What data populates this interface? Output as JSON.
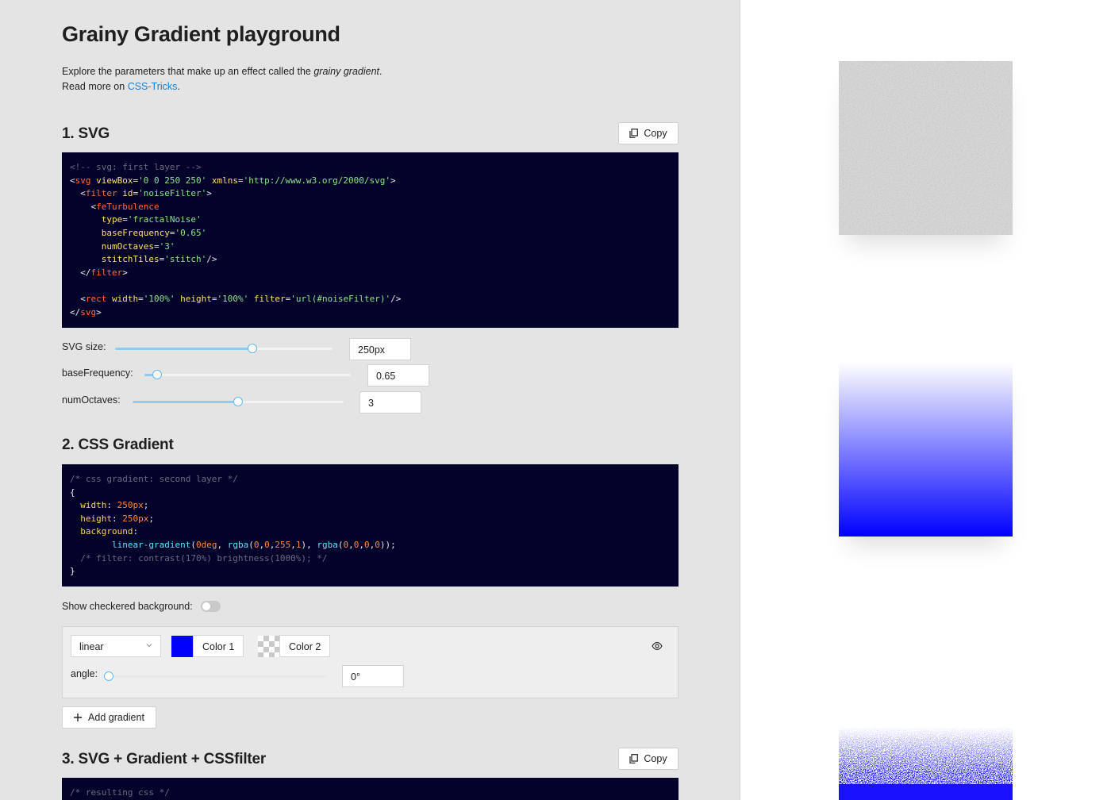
{
  "page": {
    "title": "Grainy Gradient playground",
    "intro_line1_prefix": "Explore the parameters that make up an effect called the ",
    "intro_line1_em": "grainy gradient",
    "intro_line1_suffix": ".",
    "intro_line2_prefix": "Read more on ",
    "intro_link": "CSS-Tricks",
    "intro_line2_suffix": "."
  },
  "section1": {
    "heading": "1. SVG",
    "copy_label": "Copy",
    "code_lines": [
      [
        {
          "c": "cm",
          "t": "<!-- svg: first layer -->"
        }
      ],
      [
        {
          "c": "pn",
          "t": "<"
        },
        {
          "c": "tg",
          "t": "svg"
        },
        {
          "c": "pn",
          "t": " "
        },
        {
          "c": "at",
          "t": "viewBox"
        },
        {
          "c": "pn",
          "t": "="
        },
        {
          "c": "st",
          "t": "'0 0 250 250'"
        },
        {
          "c": "pn",
          "t": " "
        },
        {
          "c": "at",
          "t": "xmlns"
        },
        {
          "c": "pn",
          "t": "="
        },
        {
          "c": "st",
          "t": "'http://www.w3.org/2000/svg'"
        },
        {
          "c": "pn",
          "t": ">"
        }
      ],
      [
        {
          "c": "pn",
          "t": "  <"
        },
        {
          "c": "tg",
          "t": "filter"
        },
        {
          "c": "pn",
          "t": " "
        },
        {
          "c": "at",
          "t": "id"
        },
        {
          "c": "pn",
          "t": "="
        },
        {
          "c": "st",
          "t": "'noiseFilter'"
        },
        {
          "c": "pn",
          "t": ">"
        }
      ],
      [
        {
          "c": "pn",
          "t": "    <"
        },
        {
          "c": "tg",
          "t": "feTurbulence"
        }
      ],
      [
        {
          "c": "pn",
          "t": "      "
        },
        {
          "c": "at",
          "t": "type"
        },
        {
          "c": "pn",
          "t": "="
        },
        {
          "c": "st",
          "t": "'fractalNoise'"
        }
      ],
      [
        {
          "c": "pn",
          "t": "      "
        },
        {
          "c": "at",
          "t": "baseFrequency"
        },
        {
          "c": "pn",
          "t": "="
        },
        {
          "c": "st",
          "t": "'0.65'"
        }
      ],
      [
        {
          "c": "pn",
          "t": "      "
        },
        {
          "c": "at",
          "t": "numOctaves"
        },
        {
          "c": "pn",
          "t": "="
        },
        {
          "c": "st",
          "t": "'3'"
        }
      ],
      [
        {
          "c": "pn",
          "t": "      "
        },
        {
          "c": "at",
          "t": "stitchTiles"
        },
        {
          "c": "pn",
          "t": "="
        },
        {
          "c": "st",
          "t": "'stitch'"
        },
        {
          "c": "pn",
          "t": "/>"
        }
      ],
      [
        {
          "c": "pn",
          "t": "  </"
        },
        {
          "c": "tg",
          "t": "filter"
        },
        {
          "c": "pn",
          "t": ">"
        }
      ],
      [
        {
          "c": "pn",
          "t": ""
        }
      ],
      [
        {
          "c": "pn",
          "t": "  <"
        },
        {
          "c": "tg",
          "t": "rect"
        },
        {
          "c": "pn",
          "t": " "
        },
        {
          "c": "at",
          "t": "width"
        },
        {
          "c": "pn",
          "t": "="
        },
        {
          "c": "st",
          "t": "'100%'"
        },
        {
          "c": "pn",
          "t": " "
        },
        {
          "c": "at",
          "t": "height"
        },
        {
          "c": "pn",
          "t": "="
        },
        {
          "c": "st",
          "t": "'100%'"
        },
        {
          "c": "pn",
          "t": " "
        },
        {
          "c": "at",
          "t": "filter"
        },
        {
          "c": "pn",
          "t": "="
        },
        {
          "c": "st",
          "t": "'url(#noiseFilter)'"
        },
        {
          "c": "pn",
          "t": "/>"
        }
      ],
      [
        {
          "c": "pn",
          "t": "</"
        },
        {
          "c": "tg",
          "t": "svg"
        },
        {
          "c": "pn",
          "t": ">"
        }
      ]
    ],
    "controls": [
      {
        "label": "SVG size",
        "value": "250px",
        "fraction": 0.63
      },
      {
        "label": "baseFrequency",
        "value": "0.65",
        "fraction": 0.06
      },
      {
        "label": "numOctaves",
        "value": "3",
        "fraction": 0.5
      }
    ]
  },
  "section2": {
    "heading": "2. CSS Gradient",
    "code_lines": [
      [
        {
          "c": "cm",
          "t": "/* css gradient: second layer */"
        }
      ],
      [
        {
          "c": "pn",
          "t": "{"
        }
      ],
      [
        {
          "c": "pn",
          "t": "  "
        },
        {
          "c": "pr",
          "t": "width"
        },
        {
          "c": "pn",
          "t": ": "
        },
        {
          "c": "nu",
          "t": "250px"
        },
        {
          "c": "pn",
          "t": ";"
        }
      ],
      [
        {
          "c": "pn",
          "t": "  "
        },
        {
          "c": "pr",
          "t": "height"
        },
        {
          "c": "pn",
          "t": ": "
        },
        {
          "c": "nu",
          "t": "250px"
        },
        {
          "c": "pn",
          "t": ";"
        }
      ],
      [
        {
          "c": "pn",
          "t": "  "
        },
        {
          "c": "pr",
          "t": "background"
        },
        {
          "c": "pn",
          "t": ":"
        }
      ],
      [
        {
          "c": "pn",
          "t": "        "
        },
        {
          "c": "fn",
          "t": "linear-gradient"
        },
        {
          "c": "pn",
          "t": "("
        },
        {
          "c": "nu",
          "t": "0deg"
        },
        {
          "c": "pn",
          "t": ", "
        },
        {
          "c": "fn",
          "t": "rgba"
        },
        {
          "c": "pn",
          "t": "("
        },
        {
          "c": "nu",
          "t": "0"
        },
        {
          "c": "pn",
          "t": ","
        },
        {
          "c": "nu",
          "t": "0"
        },
        {
          "c": "pn",
          "t": ","
        },
        {
          "c": "nu",
          "t": "255"
        },
        {
          "c": "pn",
          "t": ","
        },
        {
          "c": "nu",
          "t": "1"
        },
        {
          "c": "pn",
          "t": "), "
        },
        {
          "c": "fn",
          "t": "rgba"
        },
        {
          "c": "pn",
          "t": "("
        },
        {
          "c": "nu",
          "t": "0"
        },
        {
          "c": "pn",
          "t": ","
        },
        {
          "c": "nu",
          "t": "0"
        },
        {
          "c": "pn",
          "t": ","
        },
        {
          "c": "nu",
          "t": "0"
        },
        {
          "c": "pn",
          "t": ","
        },
        {
          "c": "nu",
          "t": "0"
        },
        {
          "c": "pn",
          "t": "));"
        }
      ],
      [
        {
          "c": "pn",
          "t": "  "
        },
        {
          "c": "cm",
          "t": "/* filter: contrast(170%) brightness(1000%); */"
        }
      ],
      [
        {
          "c": "pn",
          "t": "}"
        }
      ]
    ],
    "checkered_label": "Show checkered background",
    "checkered_on": false,
    "gradient": {
      "type": "linear",
      "color1_label": "Color 1",
      "color1": "#0000ff",
      "color2_label": "Color 2",
      "angle_label": "angle",
      "angle_value": "0°",
      "angle_fraction": 0.0
    },
    "add_gradient_label": "Add gradient"
  },
  "section3": {
    "heading": "3. SVG + Gradient + CSSfilter",
    "copy_label": "Copy",
    "code_lines": [
      [
        {
          "c": "cm",
          "t": "/* resulting css */"
        }
      ]
    ]
  },
  "colors": {
    "accent": "#63b7ea",
    "link": "#1a7fd4",
    "code_bg": "#03022a",
    "gradient_blue": "#0000ff"
  }
}
